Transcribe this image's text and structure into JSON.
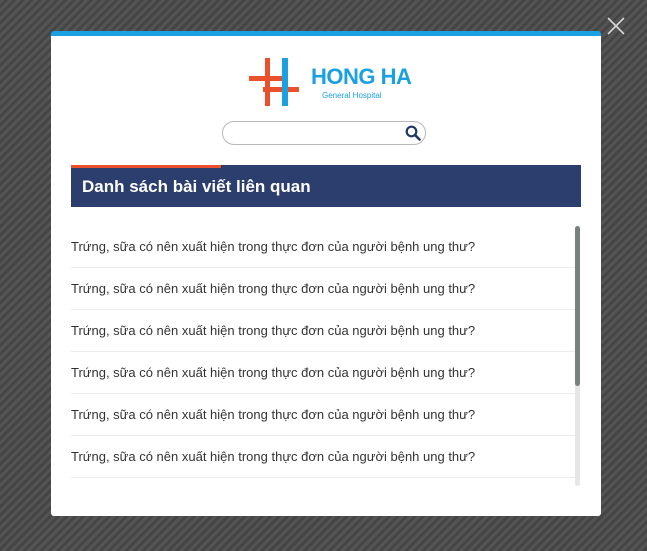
{
  "modal": {
    "logo": {
      "name": "HONG HA",
      "subtitle": "General Hospital",
      "colors": {
        "red": "#e8512b",
        "blue": "#1ba1e2"
      }
    },
    "search": {
      "value": "",
      "placeholder": ""
    },
    "section": {
      "title": "Danh sách bài viết liên quan"
    },
    "articles": [
      {
        "title": "Trứng, sữa có nên xuất hiện trong thực đơn của người bệnh ung thư?"
      },
      {
        "title": "Trứng, sữa có nên xuất hiện trong thực đơn của người bệnh ung thư?"
      },
      {
        "title": "Trứng, sữa có nên xuất hiện trong thực đơn của người bệnh ung thư?"
      },
      {
        "title": "Trứng, sữa có nên xuất hiện trong thực đơn của người bệnh ung thư?"
      },
      {
        "title": "Trứng, sữa có nên xuất hiện trong thực đơn của người bệnh ung thư?"
      },
      {
        "title": "Trứng, sữa có nên xuất hiện trong thực đơn của người bệnh ung thư?"
      }
    ]
  },
  "icons": {
    "close": "close-icon",
    "search": "search-icon",
    "logo": "hospital-cross-logo-icon"
  },
  "colors": {
    "accent_top": "#1ba1e2",
    "header_bg": "#2b3e6d",
    "header_accent": "#e8512b"
  }
}
